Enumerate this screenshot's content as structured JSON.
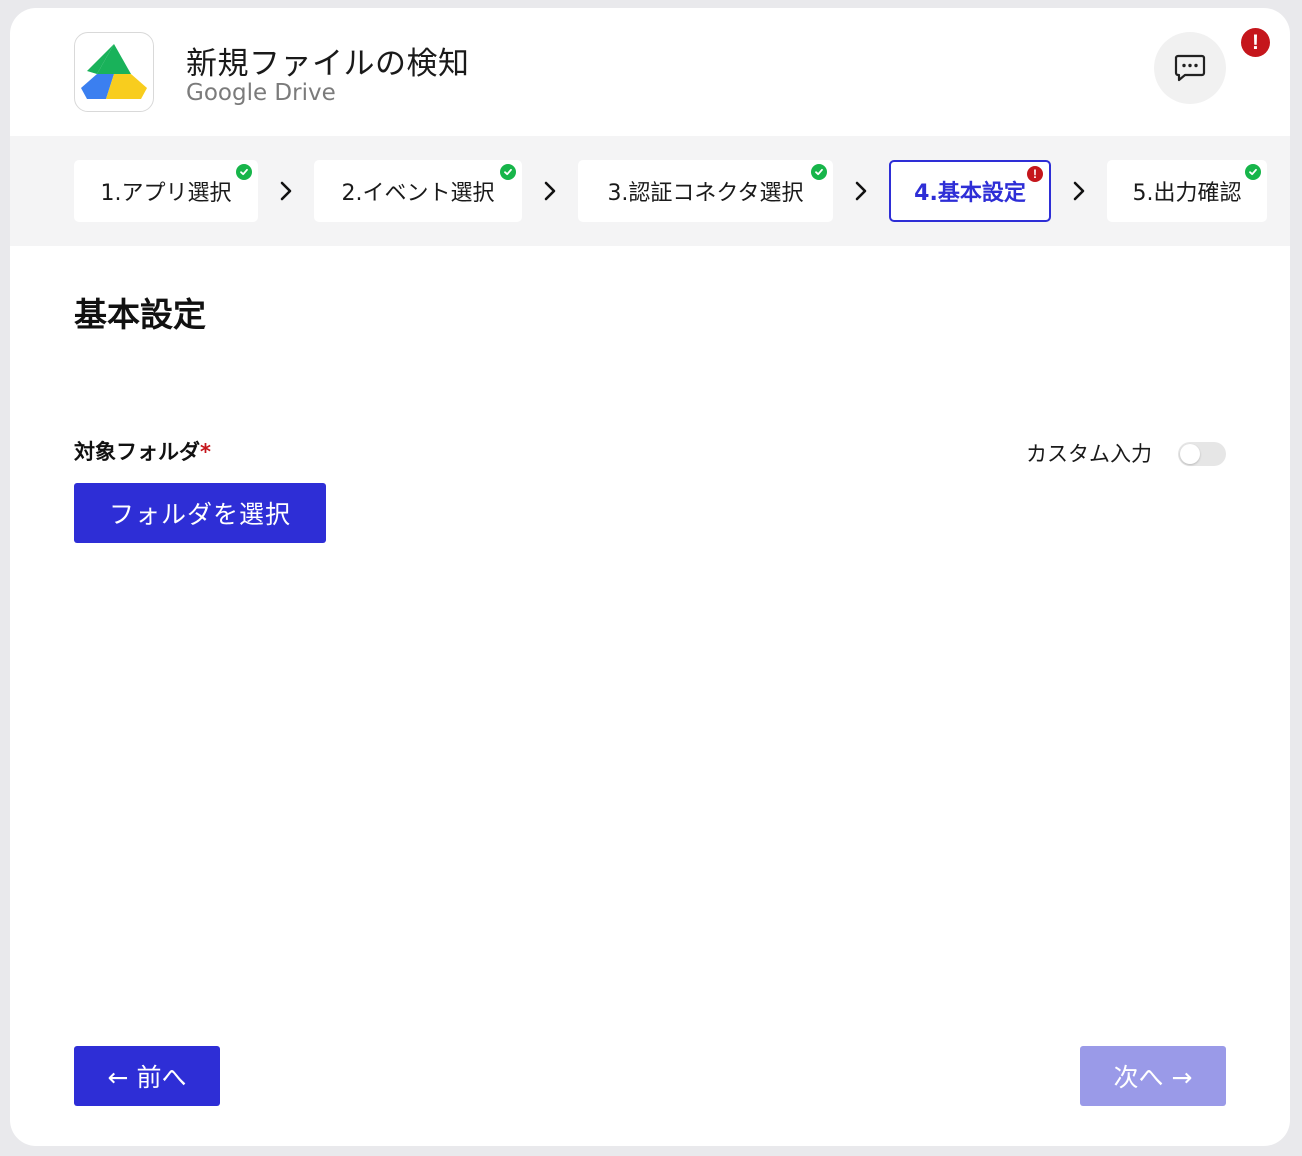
{
  "header": {
    "title": "新規ファイルの検知",
    "subtitle": "Google Drive",
    "logo_icon": "google-drive-logo-icon",
    "chat_icon": "chat-bubble-icon",
    "alert_badge": "!"
  },
  "stepper": {
    "steps": [
      {
        "label": "1.アプリ選択",
        "status": "complete"
      },
      {
        "label": "2.イベント選択",
        "status": "complete"
      },
      {
        "label": "3.認証コネクタ選択",
        "status": "complete"
      },
      {
        "label": "4.基本設定",
        "status": "error",
        "active": true
      },
      {
        "label": "5.出力確認",
        "status": "complete"
      }
    ],
    "separator_icon": "chevron-right-icon",
    "error_mark": "!"
  },
  "main": {
    "section_title": "基本設定",
    "field_label": "対象フォルダ",
    "required_mark": "*",
    "custom_input_label": "カスタム入力",
    "custom_input_enabled": false,
    "select_folder_button": "フォルダを選択"
  },
  "footer": {
    "prev_label": "← 前へ",
    "next_label": "次へ →",
    "next_enabled": false
  },
  "colors": {
    "accent": "#2e2ed6",
    "accent_disabled": "#9a9ae8",
    "success": "#17b54a",
    "error": "#c5161c"
  }
}
